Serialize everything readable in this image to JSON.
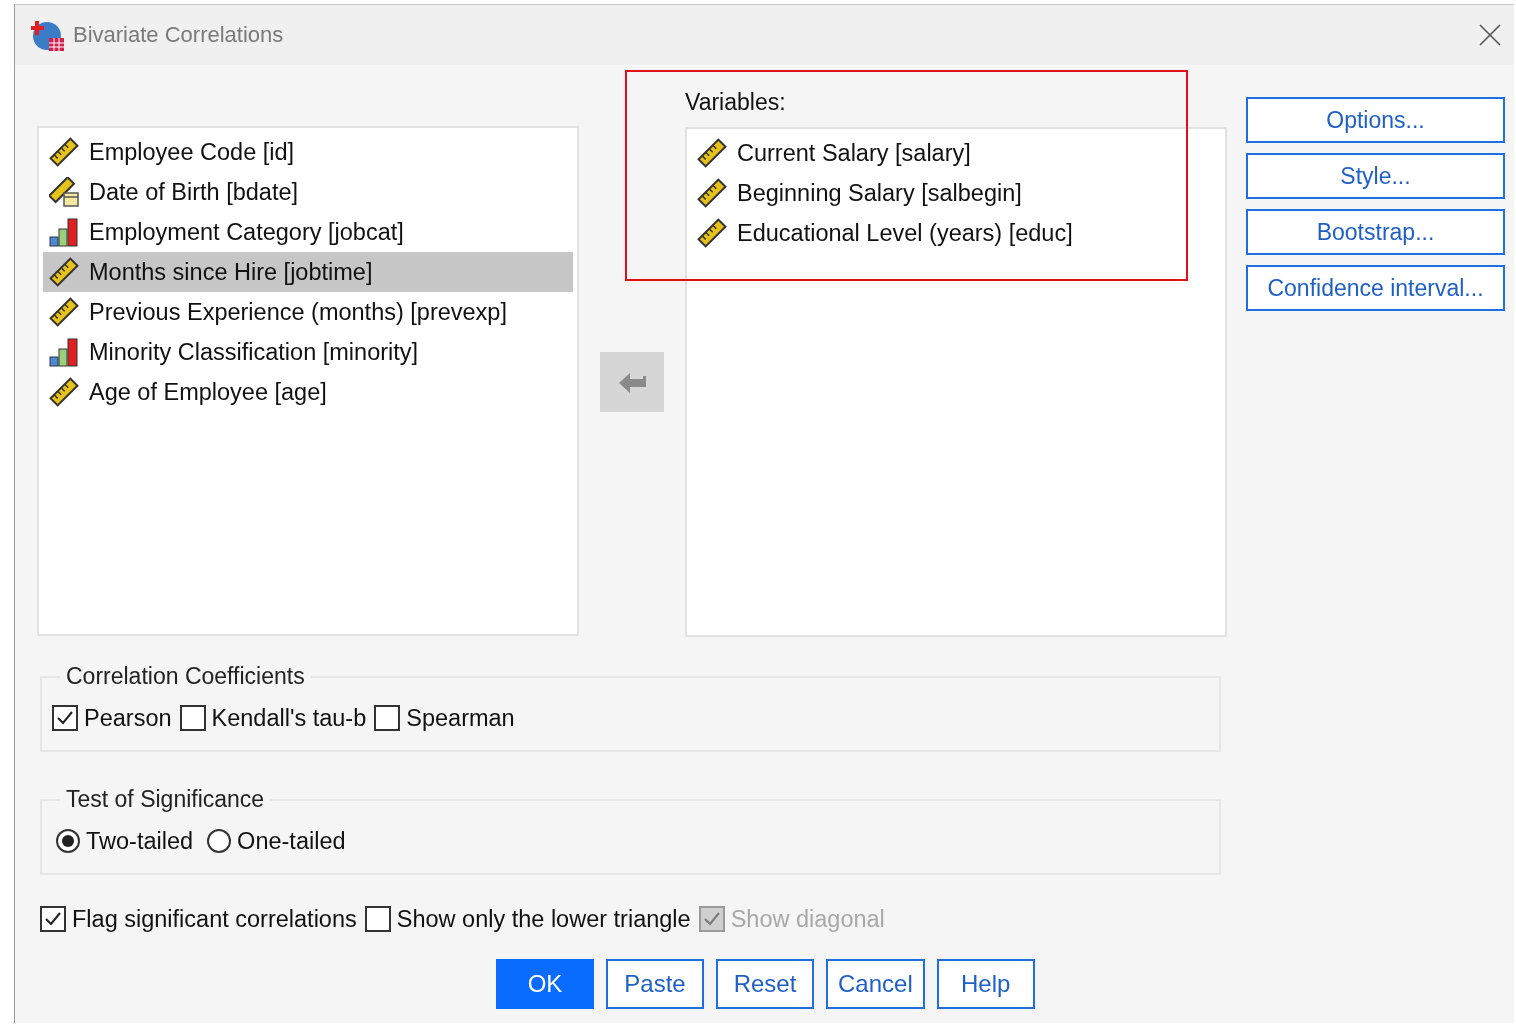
{
  "window": {
    "title": "Bivariate Correlations"
  },
  "source_list": {
    "items": [
      {
        "label": "Employee Code [id]",
        "kind": "scale",
        "selected": false
      },
      {
        "label": "Date of Birth [bdate]",
        "kind": "date",
        "selected": false
      },
      {
        "label": "Employment Category [jobcat]",
        "kind": "nominal",
        "selected": false
      },
      {
        "label": "Months since Hire [jobtime]",
        "kind": "scale",
        "selected": true
      },
      {
        "label": "Previous Experience (months) [prevexp]",
        "kind": "scale",
        "selected": false
      },
      {
        "label": "Minority Classification [minority]",
        "kind": "nominal",
        "selected": false
      },
      {
        "label": "Age of  Employee [age]",
        "kind": "scale",
        "selected": false
      }
    ]
  },
  "variables": {
    "label": "Variables:",
    "items": [
      {
        "label": "Current Salary [salary]",
        "kind": "scale",
        "selected": false
      },
      {
        "label": "Beginning Salary [salbegin]",
        "kind": "scale",
        "selected": false
      },
      {
        "label": "Educational Level (years) [educ]",
        "kind": "scale",
        "selected": false
      }
    ]
  },
  "side_buttons": [
    {
      "label": "Options..."
    },
    {
      "label": "Style..."
    },
    {
      "label": "Bootstrap..."
    },
    {
      "label": "Confidence interval..."
    }
  ],
  "coefficients": {
    "title": "Correlation Coefficients",
    "options": [
      {
        "label": "Pearson",
        "checked": true
      },
      {
        "label": "Kendall's tau-b",
        "checked": false
      },
      {
        "label": "Spearman",
        "checked": false
      }
    ]
  },
  "significance": {
    "title": "Test of Significance",
    "options": [
      {
        "label": "Two-tailed",
        "selected": true
      },
      {
        "label": "One-tailed",
        "selected": false
      }
    ]
  },
  "flags": [
    {
      "label": "Flag significant correlations",
      "checked": true,
      "disabled": false
    },
    {
      "label": "Show only the lower triangle",
      "checked": false,
      "disabled": false
    },
    {
      "label": "Show diagonal",
      "checked": true,
      "disabled": true
    }
  ],
  "buttons": [
    {
      "label": "OK",
      "default": true
    },
    {
      "label": "Paste",
      "default": false
    },
    {
      "label": "Reset",
      "default": false
    },
    {
      "label": "Cancel",
      "default": false
    },
    {
      "label": "Help",
      "default": false
    }
  ]
}
